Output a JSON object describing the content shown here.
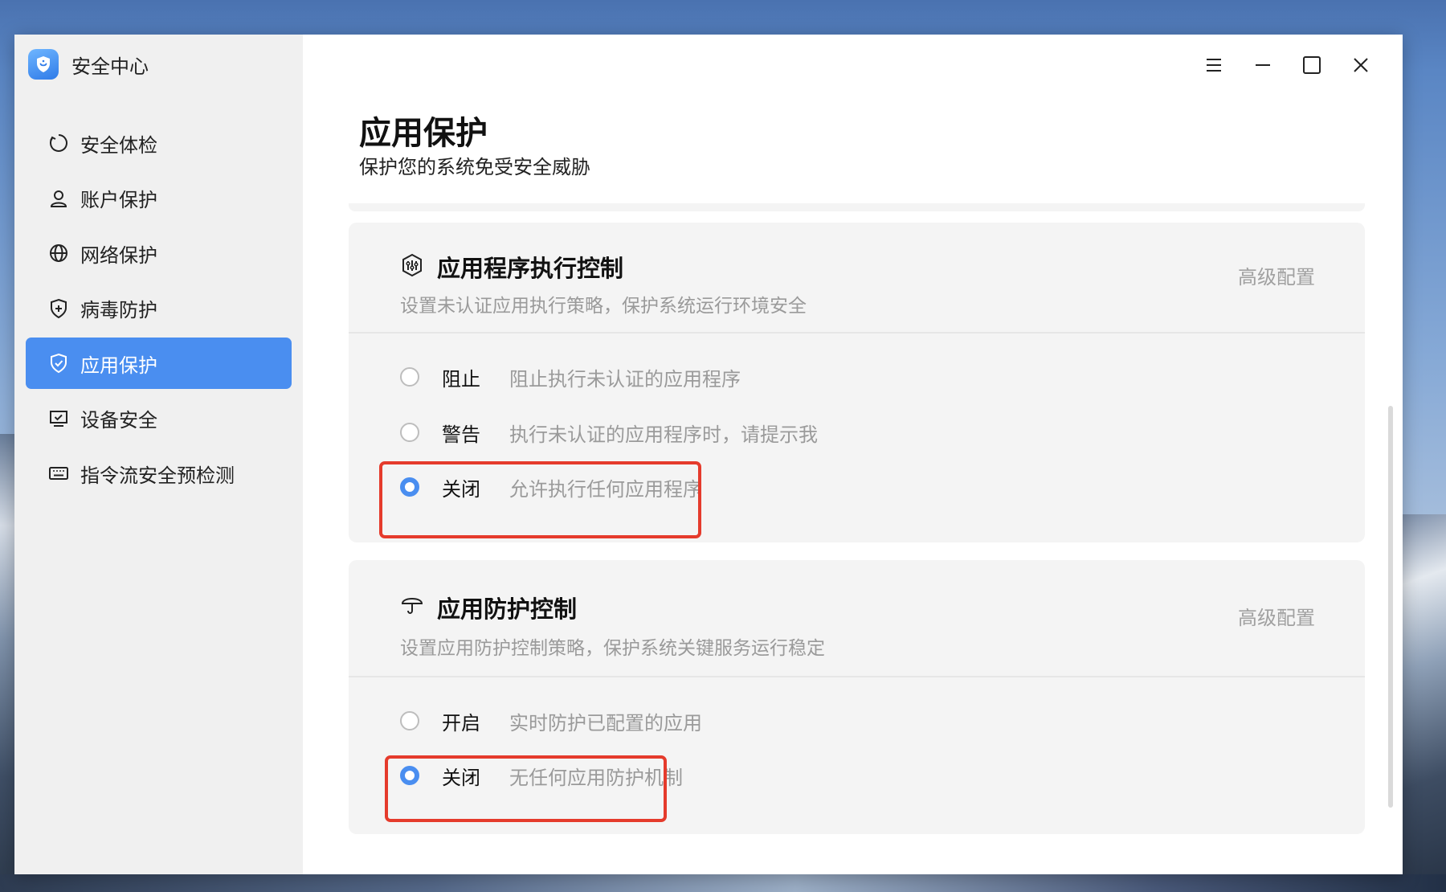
{
  "app": {
    "title": "安全中心"
  },
  "sidebar": {
    "items": [
      {
        "label": "安全体检",
        "icon": "scan-circle-icon",
        "active": false
      },
      {
        "label": "账户保护",
        "icon": "user-icon",
        "active": false
      },
      {
        "label": "网络保护",
        "icon": "globe-icon",
        "active": false
      },
      {
        "label": "病毒防护",
        "icon": "shield-plus-icon",
        "active": false
      },
      {
        "label": "应用保护",
        "icon": "shield-check-icon",
        "active": true
      },
      {
        "label": "设备安全",
        "icon": "monitor-check-icon",
        "active": false
      },
      {
        "label": "指令流安全预检测",
        "icon": "keyboard-icon",
        "active": false
      }
    ]
  },
  "header": {
    "title": "应用保护",
    "subtitle": "保护您的系统免受安全威胁"
  },
  "window_controls": [
    "menu-icon",
    "minimize-icon",
    "maximize-icon",
    "close-icon"
  ],
  "cards": [
    {
      "title": "应用程序执行控制",
      "description": "设置未认证应用执行策略，保护系统运行环境安全",
      "advanced": "高级配置",
      "icon": "app-execution-icon",
      "options": [
        {
          "label": "阻止",
          "desc": "阻止执行未认证的应用程序",
          "checked": false
        },
        {
          "label": "警告",
          "desc": "执行未认证的应用程序时，请提示我",
          "checked": false
        },
        {
          "label": "关闭",
          "desc": "允许执行任何应用程序",
          "checked": true
        }
      ]
    },
    {
      "title": "应用防护控制",
      "description": "设置应用防护控制策略，保护系统关键服务运行稳定",
      "advanced": "高级配置",
      "icon": "umbrella-icon",
      "options": [
        {
          "label": "开启",
          "desc": "实时防护已配置的应用",
          "checked": false
        },
        {
          "label": "关闭",
          "desc": "无任何应用防护机制",
          "checked": true
        }
      ]
    }
  ],
  "colors": {
    "accent": "#4a8ef0",
    "highlight": "#e53b2c"
  }
}
